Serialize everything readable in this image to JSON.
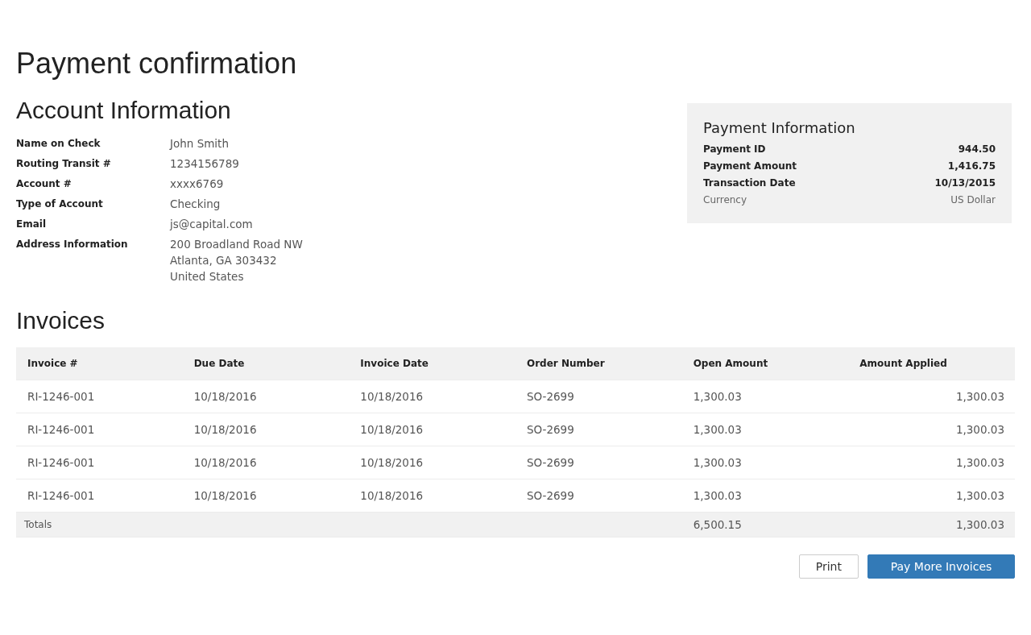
{
  "title": "Payment confirmation",
  "account": {
    "heading": "Account Information",
    "fields": [
      {
        "label": "Name on Check",
        "lines": [
          "John Smith"
        ]
      },
      {
        "label": "Routing Transit #",
        "lines": [
          "1234156789"
        ]
      },
      {
        "label": "Account #",
        "lines": [
          "xxxx6769"
        ]
      },
      {
        "label": "Type of Account",
        "lines": [
          "Checking"
        ]
      },
      {
        "label": "Email",
        "lines": [
          "js@capital.com"
        ]
      },
      {
        "label": "Address Information",
        "lines": [
          "200 Broadland Road NW",
          "Atlanta, GA 303432",
          "United States"
        ]
      }
    ]
  },
  "payment": {
    "heading": "Payment Information",
    "rows": [
      {
        "label": "Payment ID",
        "value": "944.50",
        "bold": true
      },
      {
        "label": "Payment Amount",
        "value": "1,416.75",
        "bold": true
      },
      {
        "label": "Transaction Date",
        "value": "10/13/2015",
        "bold": true
      },
      {
        "label": "Currency",
        "value": "US Dollar",
        "bold": false
      }
    ]
  },
  "invoices": {
    "heading": "Invoices",
    "columns": [
      "Invoice #",
      "Due Date",
      "Invoice Date",
      "Order Number",
      "Open Amount",
      "Amount Applied"
    ],
    "rows": [
      [
        "RI-1246-001",
        "10/18/2016",
        "10/18/2016",
        "SO-2699",
        "1,300.03",
        "1,300.03"
      ],
      [
        "RI-1246-001",
        "10/18/2016",
        "10/18/2016",
        "SO-2699",
        "1,300.03",
        "1,300.03"
      ],
      [
        "RI-1246-001",
        "10/18/2016",
        "10/18/2016",
        "SO-2699",
        "1,300.03",
        "1,300.03"
      ],
      [
        "RI-1246-001",
        "10/18/2016",
        "10/18/2016",
        "SO-2699",
        "1,300.03",
        "1,300.03"
      ]
    ],
    "totals": {
      "label": "Totals",
      "open_amount": "6,500.15",
      "amount_applied": "1,300.03"
    }
  },
  "buttons": [
    {
      "label": "Print",
      "kind": "secondary"
    },
    {
      "label": "Pay More Invoices",
      "kind": "primary"
    }
  ]
}
